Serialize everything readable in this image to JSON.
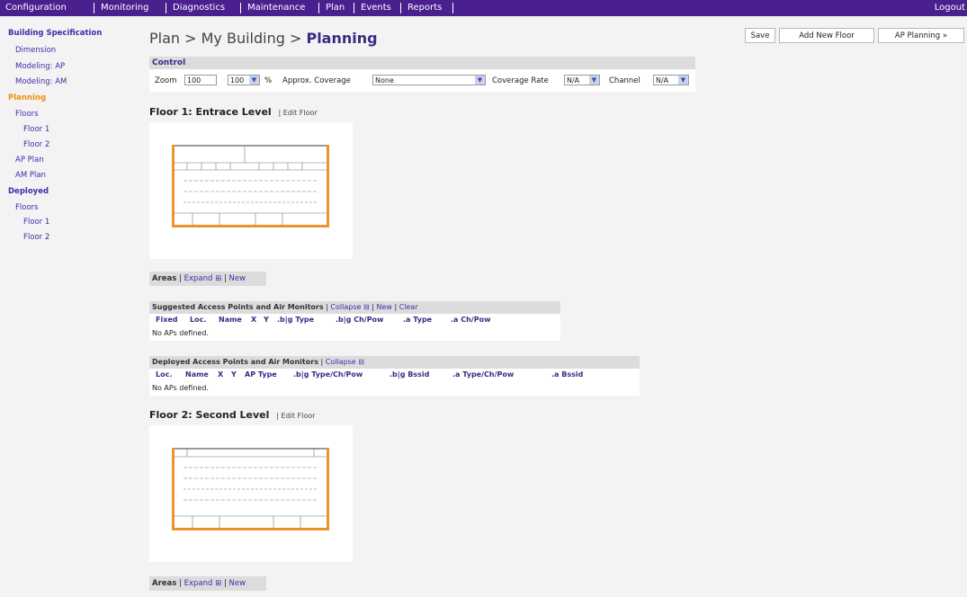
{
  "menu": {
    "items": [
      "Configuration",
      "Monitoring",
      "Diagnostics",
      "Maintenance",
      "Plan",
      "Events",
      "Reports"
    ],
    "logout": "Logout",
    "bar_color": "#4a1f8e"
  },
  "sidebar": {
    "building_spec": "Building Specification",
    "dimension": "Dimension",
    "modeling_ap": "Modeling: AP",
    "modeling_am": "Modeling: AM",
    "planning": "Planning",
    "floors": "Floors",
    "floor1": "Floor 1",
    "floor2": "Floor 2",
    "ap_plan": "AP Plan",
    "am_plan": "AM Plan",
    "deployed": "Deployed",
    "dep_floors": "Floors",
    "dep_floor1": "Floor 1",
    "dep_floor2": "Floor 2"
  },
  "header": {
    "breadcrumb": "Plan > My Building > ",
    "current": "Planning",
    "save": "Save",
    "add_floor": "Add New Floor",
    "ap_planning": "AP Planning »"
  },
  "control": {
    "title": "Control",
    "zoom_label": "Zoom",
    "zoom_value": "100",
    "zoom_select": "100",
    "percent": "%",
    "coverage_label": "Approx. Coverage",
    "coverage_value": "None",
    "rate_label": "Coverage Rate",
    "rate_value": "N/A",
    "channel_label": "Channel",
    "channel_value": "N/A"
  },
  "floors": [
    {
      "title": "Floor 1: Entrace Level",
      "edit": "Edit Floor",
      "areas_label": "Areas",
      "expand": "Expand",
      "new": "New"
    },
    {
      "title": "Floor 2: Second Level",
      "edit": "Edit Floor",
      "areas_label": "Areas",
      "expand": "Expand",
      "new": "New"
    }
  ],
  "suggested": {
    "title": "Suggested Access Points and Air Monitors",
    "collapse": "Collapse",
    "new": "New",
    "clear": "Clear",
    "columns": [
      "Fixed",
      "Loc.",
      "Name",
      "X",
      "Y",
      ".b|g Type",
      ".b|g Ch/Pow",
      ".a Type",
      ".a Ch/Pow"
    ],
    "empty": "No APs defined."
  },
  "deployed": {
    "title": "Deployed Access Points and Air Monitors",
    "collapse": "Collapse",
    "columns": [
      "Loc.",
      "Name",
      "X",
      "Y",
      "AP Type",
      ".b|g Type/Ch/Pow",
      ".b|g Bssid",
      ".a Type/Ch/Pow",
      ".a Bssid"
    ],
    "empty": "No APs defined."
  },
  "colors": {
    "accent": "#3b2a84",
    "active": "#f08c10",
    "floorplan": "#e8962a"
  }
}
